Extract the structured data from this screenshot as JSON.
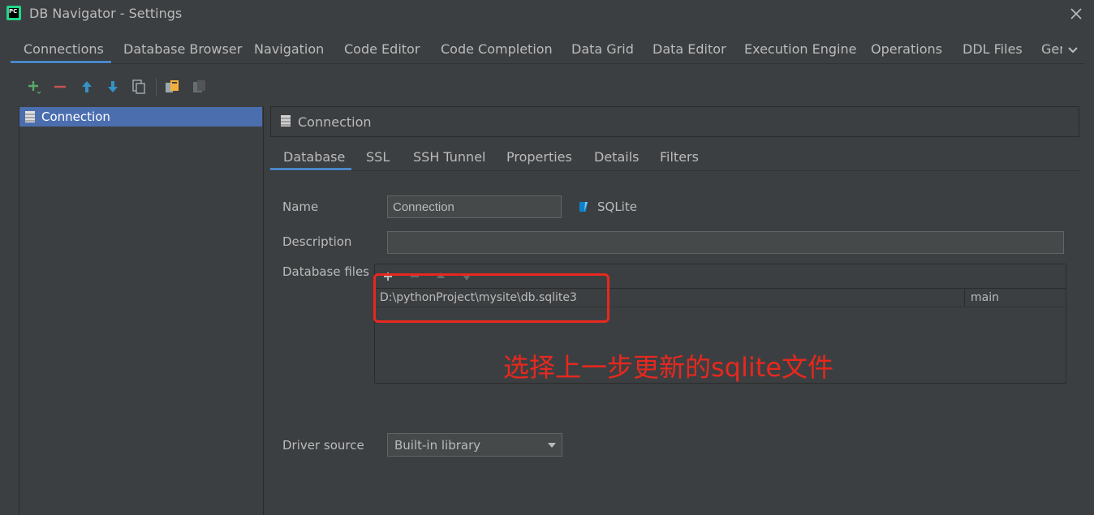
{
  "window": {
    "title": "DB Navigator - Settings",
    "app_icon": "PC"
  },
  "top_tabs": [
    "Connections",
    "Database Browser",
    "Navigation",
    "Code Editor",
    "Code Completion",
    "Data Grid",
    "Data Editor",
    "Execution Engine",
    "Operations",
    "DDL Files"
  ],
  "top_tab_clipped": "General",
  "left_panel": {
    "items": [
      "Connection"
    ]
  },
  "connection": {
    "header": "Connection",
    "tabs": [
      "Database",
      "SSL",
      "SSH Tunnel",
      "Properties",
      "Details",
      "Filters"
    ],
    "name_label": "Name",
    "name_value": "Connection",
    "db_type": "SQLite",
    "description_label": "Description",
    "description_value": "",
    "files_label": "Database files",
    "files": [
      {
        "path": "D:\\pythonProject\\mysite\\db.sqlite3",
        "schema": "main"
      }
    ],
    "driver_label": "Driver source",
    "driver_value": "Built-in library"
  },
  "annotation": "选择上一步更新的sqlite文件",
  "colors": {
    "accent": "#4a88c7",
    "selection": "#4b6eaf",
    "annotation": "#e8281e",
    "add": "#59a869",
    "remove": "#c75450",
    "move": "#3592c4"
  }
}
